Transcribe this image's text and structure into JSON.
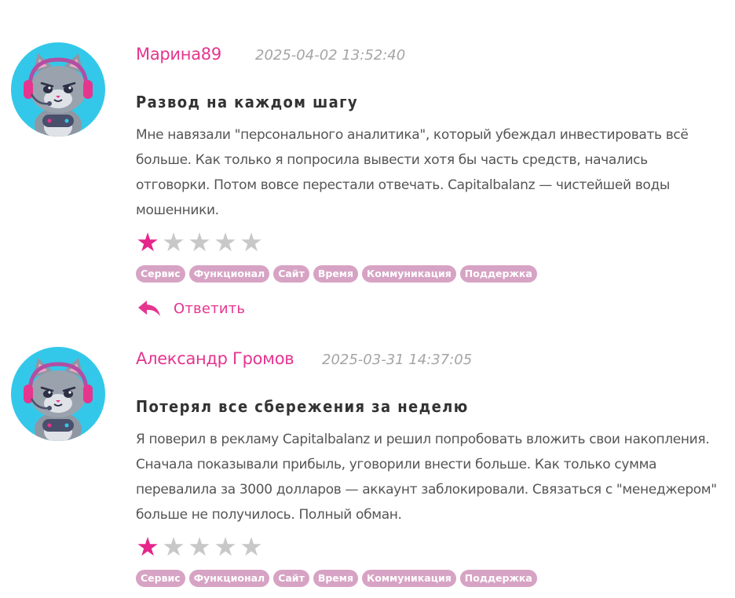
{
  "reviews": [
    {
      "author": "Марина89",
      "date": "2025-04-02 13:52:40",
      "title": "Развод на каждом шагу",
      "text": "Мне навязали \"персонального аналитика\", который убеждал инвестировать всё больше. Как только я попросила вывести хотя бы часть средств, начались отговорки. Потом вовсе перестали отвечать. Capitalbalanz — чистейшей воды мошенники.",
      "rating": 1,
      "max_rating": 5,
      "tags": [
        "Сервис",
        "Функционал",
        "Сайт",
        "Время",
        "Коммуникация",
        "Поддержка"
      ],
      "reply_label": "Ответить",
      "avatar_icon": "gamer-cat-avatar-icon"
    },
    {
      "author": "Александр Громов",
      "date": "2025-03-31 14:37:05",
      "title": "Потерял все сбережения за неделю",
      "text": "Я поверил в рекламу Capitalbalanz и решил попробовать вложить свои накопления. Сначала показывали прибыль, уговорили внести больше. Как только сумма перевалила за 3000 долларов — аккаунт заблокировали. Связаться с \"менеджером\" больше не получилось. Полный обман.",
      "rating": 1,
      "max_rating": 5,
      "tags": [
        "Сервис",
        "Функционал",
        "Сайт",
        "Время",
        "Коммуникация",
        "Поддержка"
      ],
      "avatar_icon": "gamer-cat-avatar-icon"
    }
  ],
  "colors": {
    "accent": "#e5358f",
    "star_on": "#e5268a",
    "star_off": "#c8c8c8",
    "tag_bg": "#d7a3c4",
    "avatar_bg": "#33c8e9"
  }
}
